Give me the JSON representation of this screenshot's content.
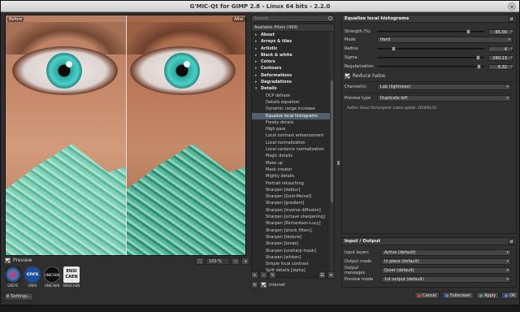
{
  "window": {
    "title": "G'MIC-Qt for GIMP 2.8 - Linux 64 bits - 2.2.0",
    "close_glyph": "✕"
  },
  "preview": {
    "left_label": "Before",
    "right_label": "After",
    "show_preview_label": "Preview",
    "zoom_value": "100 %",
    "zoom_minus": "−",
    "zoom_plus": "+",
    "zoom_fit": "⛶"
  },
  "logos": [
    {
      "name": "GREYC",
      "mark": ""
    },
    {
      "name": "CNRS",
      "mark": "cnrs"
    },
    {
      "name": "UNICAEN",
      "mark": "UNICAEN"
    },
    {
      "name": "ENSICAEN",
      "mark": "ENSI CAEN"
    }
  ],
  "settings_button": "⚙ Settings...",
  "filters": {
    "search_placeholder": "Search",
    "available_label": "Available filters (499)",
    "categories_before": [
      {
        "label": "About",
        "arrow": "▸"
      },
      {
        "label": "Arrays & tiles",
        "arrow": "▸"
      },
      {
        "label": "Artistic",
        "arrow": "▸"
      },
      {
        "label": "Black & white",
        "arrow": "▸"
      },
      {
        "label": "Colors",
        "arrow": "▸"
      },
      {
        "label": "Contours",
        "arrow": "▸"
      },
      {
        "label": "Deformations",
        "arrow": "▸"
      },
      {
        "label": "Degradations",
        "arrow": "▸"
      },
      {
        "label": "Details",
        "arrow": "▾"
      }
    ],
    "details_items": [
      "DCP dehaze",
      "Details equalizer",
      "Dynamic range increase",
      "Equalize local histograms",
      "Freaky details",
      "High pass",
      "Local contrast enhancement",
      "Local normalization",
      "Local variance normalization",
      "Magic details",
      "Make up",
      "Mask creator",
      "Mighty details",
      "Portrait retouching",
      "Sharpen [deblur]",
      "Sharpen [Gold-Meinel]",
      "Sharpen [gradient]",
      "Sharpen [inverse diffusion]",
      "Sharpen [octave sharpening]",
      "Sharpen [Richardson-Lucy]",
      "Sharpen [shock filters]",
      "Sharpen [texture]",
      "Sharpen [tones]",
      "Sharpen [unsharp mask]",
      "Sharpen [whiten]",
      "Simple local contrast",
      "Split details [alpha]"
    ],
    "selected_index": 3,
    "internet_label": "Internet",
    "tool_icons": {
      "add_fave": "+",
      "remove_fave": "−",
      "rename": "✎",
      "toggle": "☰",
      "collapse": "▾",
      "refresh": "↻"
    }
  },
  "params": {
    "title": "Equalize local histograms",
    "reset_glyph": "↺",
    "strength": {
      "label": "Strength (%)",
      "value": "85.00",
      "fraction": 0.85
    },
    "mode": {
      "label": "Mode",
      "value": "Hard"
    },
    "radius": {
      "label": "Radius",
      "value": "4",
      "fraction": 0.15
    },
    "sigma": {
      "label": "Sigma",
      "value": "240.13",
      "fraction": 0.94
    },
    "regularization": {
      "label": "Regularization",
      "value": "6.32",
      "fraction": 0.95
    },
    "reduce_halos": {
      "label": "Reduce halos",
      "checked": true
    },
    "channels": {
      "label": "Channel(s)",
      "value": "Lab (lightness)"
    },
    "preview_type": {
      "label": "Preview type",
      "value": "Duplicate left"
    },
    "author": "Author: David Tschumperlé.   Latest update: 2018/01/31."
  },
  "io": {
    "title": "Input / Output",
    "reset_glyph": "↺",
    "input_layers": {
      "label": "Input layers",
      "value": "Active (default)"
    },
    "output_mode": {
      "label": "Output mode",
      "value": "In place (default)"
    },
    "output_messages": {
      "label": "Output messages",
      "value": "Quiet (default)"
    },
    "preview_mode": {
      "label": "Preview mode",
      "value": "1st output (default)"
    }
  },
  "buttons": {
    "cancel": "Cancel",
    "fullscreen": "Fullscreen",
    "apply": "Apply",
    "ok": "OK"
  },
  "colors": {
    "selected_row": "#51606d",
    "cancel_dot": "#d04040",
    "apply_dot": "#50a050",
    "ok_dot": "#5080d0",
    "fullscreen_dot": "#5080d0"
  }
}
